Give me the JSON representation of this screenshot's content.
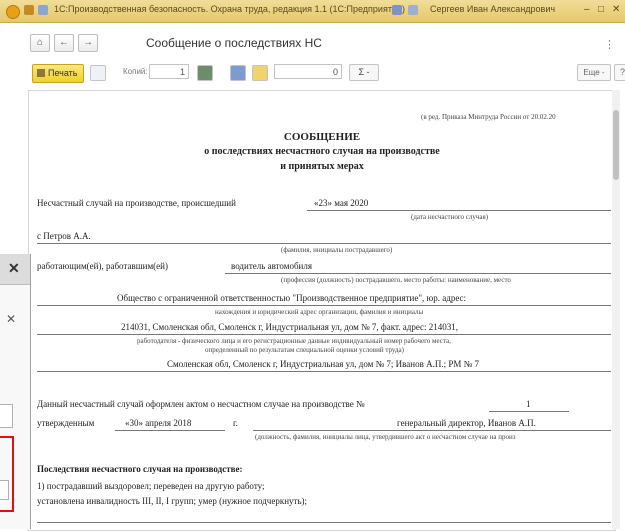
{
  "titlebar": {
    "app_title": "1С:Производственная безопасность. Охрана труда, редакция 1.1 (1С:Предприятие)",
    "user": "Сергеев Иван Александрович",
    "minimize": "–",
    "maximize": "□",
    "close": "✕"
  },
  "nav": {
    "home": "⌂",
    "back": "←",
    "forward": "→",
    "title": "Сообщение о последствиях НС",
    "more": "⋮"
  },
  "toolbar": {
    "print_label": "Печать",
    "copies_label": "Копий:",
    "copies_value": "1",
    "num_value": "0",
    "sigma_label": "Σ -",
    "more_label": "Еще -",
    "help_label": "?"
  },
  "document": {
    "header_note": "(в ред. Приказа Минтруда России от 20.02.20",
    "heading1": "СООБЩЕНИЕ",
    "heading2": "о последствиях несчастного случая на производстве",
    "heading3": "и принятых мерах",
    "accident_intro": "Несчастный случай на производстве, происшедший",
    "accident_date": "«23» мая 2020",
    "date_caption": "(дата несчастного случая)",
    "victim": "с Петров А.А.",
    "victim_caption": "(фамилия, инициалы пострадавшего)",
    "worker_label": "работающим(ей), работавшим(ей)",
    "position": "водитель автомобиля",
    "position_caption": "(профессия (должность) пострадавшего, место работы: наименование, место",
    "org": "Общество с ограниченной ответственностью \"Производственное предприятие\", юр. адрес:",
    "org_caption": "нахождения и юридический адрес организации, фамилия и инициалы",
    "address": "214031, Смоленская обл, Смоленск г, Индустриальная ул, дом № 7, факт. адрес: 214031,",
    "employer_caption1": "работодателя - физического лица и его регистрационные данные индивидуальный номер рабочего места,",
    "employer_caption2": "определенный по результатам специальной оценки условий труда)",
    "address2": "Смоленская обл, Смоленск г, Индустриальная ул, дом № 7; Иванов А.П.; РМ № 7",
    "act_text": "Данный несчастный случай оформлен актом о несчастном случае на производстве №",
    "act_number": "1",
    "approved_label": "утвержденным",
    "approved_date": "«30» апреля 2018",
    "year_suffix": "г.",
    "approver": "генеральный директор, Иванов А.П.",
    "approver_caption": "(должность, фамилия, инициалы лица, утвердившего акт о несчастном случае на произ",
    "consequences_title": "Последствия несчастного случая на производстве:",
    "cons1": "1)  пострадавший  выздоровел;    переведен  на  другую  работу;",
    "cons2": "установлена  инвалидность    III, II, I    групп;  умер   (нужное подчеркнуть);"
  },
  "dialog": {
    "close1": "✕",
    "close2": "✕"
  },
  "colors": {
    "titlebar": "#e5c868",
    "print_button": "#f0cf32",
    "highlight": "#e01010"
  }
}
